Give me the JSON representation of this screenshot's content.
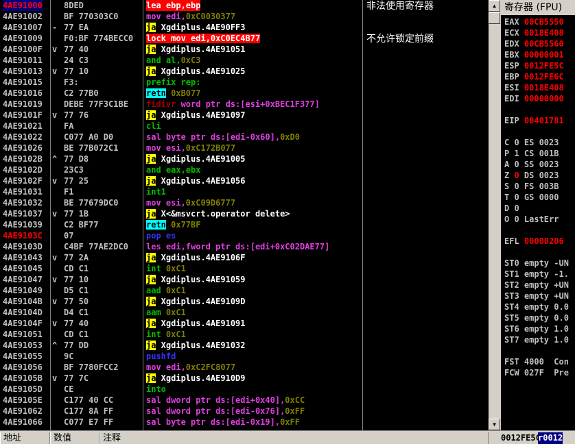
{
  "disasm": {
    "rows": [
      {
        "addr": "4AE91000",
        "jm": "",
        "hex": "8DED",
        "asm": [
          {
            "t": "lea ebp,ebp",
            "c": "mn-white"
          }
        ],
        "style": "row0"
      },
      {
        "addr": "4AE91002",
        "jm": "",
        "hex": "BF 770303C0",
        "asm": [
          {
            "t": "mov edi,",
            "c": "mn-purple"
          },
          {
            "t": "0xC0030377",
            "c": "op-num"
          }
        ]
      },
      {
        "addr": "4AE91007",
        "jm": "-",
        "hex": "77 EA",
        "asm": [
          {
            "t": "ja",
            "c": "mn-yellow"
          },
          {
            "t": " Xgdiplus.4AE90FF3",
            "c": "op-text"
          }
        ]
      },
      {
        "addr": "4AE91009",
        "jm": "",
        "hex": "F0:BF 774BECC0",
        "asm": [
          {
            "t": "lock mov edi,0xC0EC4B77",
            "c": "mn-lockbg"
          }
        ]
      },
      {
        "addr": "4AE9100F",
        "jm": "v",
        "hex": "77 40",
        "asm": [
          {
            "t": "ja",
            "c": "mn-yellow"
          },
          {
            "t": " Xgdiplus.4AE91051",
            "c": "op-text"
          }
        ]
      },
      {
        "addr": "4AE91011",
        "jm": "",
        "hex": "24 C3",
        "asm": [
          {
            "t": "and al,",
            "c": "mn-green"
          },
          {
            "t": "0xC3",
            "c": "op-num"
          }
        ]
      },
      {
        "addr": "4AE91013",
        "jm": "v",
        "hex": "77 10",
        "asm": [
          {
            "t": "ja",
            "c": "mn-yellow"
          },
          {
            "t": " Xgdiplus.4AE91025",
            "c": "op-text"
          }
        ]
      },
      {
        "addr": "4AE91015",
        "jm": "",
        "hex": "F3:",
        "asm": [
          {
            "t": "prefix rep:",
            "c": "mn-green"
          }
        ]
      },
      {
        "addr": "4AE91016",
        "jm": "",
        "hex": "C2 77B0",
        "asm": [
          {
            "t": "retn",
            "c": "mn-cyan"
          },
          {
            "t": " 0xB077",
            "c": "op-num"
          }
        ]
      },
      {
        "addr": "4AE91019",
        "jm": "",
        "hex": "DEBE 77F3C1BE",
        "asm": [
          {
            "t": "fidivr",
            "c": "mn-darkred"
          },
          {
            "t": " word ptr ds:[esi+0xBEC1F377]",
            "c": "op-purple"
          }
        ]
      },
      {
        "addr": "4AE9101F",
        "jm": "v",
        "hex": "77 76",
        "asm": [
          {
            "t": "ja",
            "c": "mn-yellow"
          },
          {
            "t": " Xgdiplus.4AE91097",
            "c": "op-text"
          }
        ]
      },
      {
        "addr": "4AE91021",
        "jm": "",
        "hex": "FA",
        "asm": [
          {
            "t": "cli",
            "c": "mn-green"
          }
        ]
      },
      {
        "addr": "4AE91022",
        "jm": "",
        "hex": "C077 A0 D0",
        "asm": [
          {
            "t": "sal byte ptr ds:[edi-0x60],",
            "c": "mn-purple"
          },
          {
            "t": "0xD0",
            "c": "op-num"
          }
        ]
      },
      {
        "addr": "4AE91026",
        "jm": "",
        "hex": "BE 77B072C1",
        "asm": [
          {
            "t": "mov esi,",
            "c": "mn-purple"
          },
          {
            "t": "0xC172B077",
            "c": "op-num"
          }
        ]
      },
      {
        "addr": "4AE9102B",
        "jm": "^",
        "hex": "77 D8",
        "asm": [
          {
            "t": "ja",
            "c": "mn-yellow"
          },
          {
            "t": " Xgdiplus.4AE91005",
            "c": "op-text"
          }
        ]
      },
      {
        "addr": "4AE9102D",
        "jm": "",
        "hex": "23C3",
        "asm": [
          {
            "t": "and eax,ebx",
            "c": "mn-green"
          }
        ]
      },
      {
        "addr": "4AE9102F",
        "jm": "v",
        "hex": "77 25",
        "asm": [
          {
            "t": "ja",
            "c": "mn-yellow"
          },
          {
            "t": " Xgdiplus.4AE91056",
            "c": "op-text"
          }
        ]
      },
      {
        "addr": "4AE91031",
        "jm": "",
        "hex": "F1",
        "asm": [
          {
            "t": "int1",
            "c": "mn-green"
          }
        ]
      },
      {
        "addr": "4AE91032",
        "jm": "",
        "hex": "BE 77679DC0",
        "asm": [
          {
            "t": "mov esi,",
            "c": "mn-purple"
          },
          {
            "t": "0xC09D6777",
            "c": "op-num"
          }
        ]
      },
      {
        "addr": "4AE91037",
        "jm": "v",
        "hex": "77 1B",
        "asm": [
          {
            "t": "ja",
            "c": "mn-yellow"
          },
          {
            "t": " X<&msvcrt.operator delete>",
            "c": "op-text"
          }
        ]
      },
      {
        "addr": "4AE91039",
        "jm": "",
        "hex": "C2 BF77",
        "asm": [
          {
            "t": "retn",
            "c": "mn-cyan"
          },
          {
            "t": " 0x77BF",
            "c": "op-num"
          }
        ]
      },
      {
        "addr": "4AE9103C",
        "jm": "",
        "hex": "07",
        "asm": [
          {
            "t": "pop es",
            "c": "mn-blue"
          }
        ],
        "addrstyle": "red"
      },
      {
        "addr": "4AE9103D",
        "jm": "",
        "hex": "C4BF 77AE2DC0",
        "asm": [
          {
            "t": "les edi,fword ptr ds:[edi+0xC02DAE77]",
            "c": "mn-purple"
          }
        ]
      },
      {
        "addr": "4AE91043",
        "jm": "v",
        "hex": "77 2A",
        "asm": [
          {
            "t": "ja",
            "c": "mn-yellow"
          },
          {
            "t": " Xgdiplus.4AE9106F",
            "c": "op-text"
          }
        ]
      },
      {
        "addr": "4AE91045",
        "jm": "",
        "hex": "CD C1",
        "asm": [
          {
            "t": "int ",
            "c": "mn-green"
          },
          {
            "t": "0xC1",
            "c": "op-num"
          }
        ]
      },
      {
        "addr": "4AE91047",
        "jm": "v",
        "hex": "77 10",
        "asm": [
          {
            "t": "ja",
            "c": "mn-yellow"
          },
          {
            "t": " Xgdiplus.4AE91059",
            "c": "op-text"
          }
        ]
      },
      {
        "addr": "4AE91049",
        "jm": "",
        "hex": "D5 C1",
        "asm": [
          {
            "t": "aad ",
            "c": "mn-green"
          },
          {
            "t": "0xC1",
            "c": "op-num"
          }
        ]
      },
      {
        "addr": "4AE9104B",
        "jm": "v",
        "hex": "77 50",
        "asm": [
          {
            "t": "ja",
            "c": "mn-yellow"
          },
          {
            "t": " Xgdiplus.4AE9109D",
            "c": "op-text"
          }
        ]
      },
      {
        "addr": "4AE9104D",
        "jm": "",
        "hex": "D4 C1",
        "asm": [
          {
            "t": "aam ",
            "c": "mn-green"
          },
          {
            "t": "0xC1",
            "c": "op-num"
          }
        ]
      },
      {
        "addr": "4AE9104F",
        "jm": "v",
        "hex": "77 40",
        "asm": [
          {
            "t": "ja",
            "c": "mn-yellow"
          },
          {
            "t": " Xgdiplus.4AE91091",
            "c": "op-text"
          }
        ]
      },
      {
        "addr": "4AE91051",
        "jm": "",
        "hex": "CD C1",
        "asm": [
          {
            "t": "int ",
            "c": "mn-green"
          },
          {
            "t": "0xC1",
            "c": "op-num"
          }
        ]
      },
      {
        "addr": "4AE91053",
        "jm": "^",
        "hex": "77 DD",
        "asm": [
          {
            "t": "ja",
            "c": "mn-yellow"
          },
          {
            "t": " Xgdiplus.4AE91032",
            "c": "op-text"
          }
        ]
      },
      {
        "addr": "4AE91055",
        "jm": "",
        "hex": "9C",
        "asm": [
          {
            "t": "pushfd",
            "c": "mn-blue"
          }
        ]
      },
      {
        "addr": "4AE91056",
        "jm": "",
        "hex": "BF 7780FCC2",
        "asm": [
          {
            "t": "mov edi,",
            "c": "mn-purple"
          },
          {
            "t": "0xC2FC8077",
            "c": "op-num"
          }
        ]
      },
      {
        "addr": "4AE9105B",
        "jm": "v",
        "hex": "77 7C",
        "asm": [
          {
            "t": "ja",
            "c": "mn-yellow"
          },
          {
            "t": " Xgdiplus.4AE910D9",
            "c": "op-text"
          }
        ]
      },
      {
        "addr": "4AE9105D",
        "jm": "",
        "hex": "CE",
        "asm": [
          {
            "t": "into",
            "c": "mn-green"
          }
        ]
      },
      {
        "addr": "4AE9105E",
        "jm": "",
        "hex": "C177 40 CC",
        "asm": [
          {
            "t": "sal dword ptr ds:[edi+0x40],",
            "c": "mn-purple"
          },
          {
            "t": "0xCC",
            "c": "op-num"
          }
        ]
      },
      {
        "addr": "4AE91062",
        "jm": "",
        "hex": "C177 8A FF",
        "asm": [
          {
            "t": "sal dword ptr ds:[edi-0x76],",
            "c": "mn-purple"
          },
          {
            "t": "0xFF",
            "c": "op-num"
          }
        ]
      },
      {
        "addr": "4AE91066",
        "jm": "",
        "hex": "C077 E7 FF",
        "asm": [
          {
            "t": "sal byte ptr ds:[edi-0x19],",
            "c": "mn-purple"
          },
          {
            "t": "0xFF",
            "c": "op-num"
          }
        ]
      }
    ],
    "comments": [
      {
        "row": 0,
        "text": "非法使用寄存器"
      },
      {
        "row": 3,
        "text": "不允许锁定前缀"
      }
    ]
  },
  "registers": {
    "title": "寄存器 (FPU)",
    "lines": [
      {
        "y": 0,
        "k": "EAX",
        "v": "00CB5550",
        "c": "rval-red"
      },
      {
        "y": 1,
        "k": "ECX",
        "v": "0018E408",
        "c": "rval-red"
      },
      {
        "y": 2,
        "k": "EDX",
        "v": "00CB5560",
        "c": "rval-red"
      },
      {
        "y": 3,
        "k": "EBX",
        "v": "00000001",
        "c": "rval-red"
      },
      {
        "y": 4,
        "k": "ESP",
        "v": "0012FE5C",
        "c": "rval-red"
      },
      {
        "y": 5,
        "k": "EBP",
        "v": "0012FE6C",
        "c": "rval-red"
      },
      {
        "y": 6,
        "k": "ESI",
        "v": "0018E408",
        "c": "rval-red"
      },
      {
        "y": 7,
        "k": "EDI",
        "v": "00000000",
        "c": "rval-red"
      },
      {
        "y": 9,
        "k": "EIP",
        "v": "00401781",
        "c": "rval-red"
      },
      {
        "y": 11,
        "k": "C 0",
        "v": "ES 0023",
        "c": "rval-gray"
      },
      {
        "y": 12,
        "k": "P 1",
        "v": "CS 001B",
        "c": "rval-gray"
      },
      {
        "y": 13,
        "k": "A 0",
        "v": "SS 0023",
        "c": "rval-gray"
      },
      {
        "y": 14,
        "k": "Z 0",
        "v": "DS 0023",
        "c": "rval-gray",
        "zred": true
      },
      {
        "y": 15,
        "k": "S 0",
        "v": "FS 003B",
        "c": "rval-gray"
      },
      {
        "y": 16,
        "k": "T 0",
        "v": "GS 0000",
        "c": "rval-gray"
      },
      {
        "y": 17,
        "k": "D 0",
        "v": "",
        "c": "rval-gray"
      },
      {
        "y": 18,
        "k": "O 0",
        "v": "LastErr",
        "c": "rval-gray"
      },
      {
        "y": 20,
        "k": "EFL",
        "v": "00000206",
        "c": "rval-red"
      },
      {
        "y": 22,
        "k": "ST0",
        "v": "empty -UN",
        "c": "rval-gray"
      },
      {
        "y": 23,
        "k": "ST1",
        "v": "empty -1.",
        "c": "rval-gray"
      },
      {
        "y": 24,
        "k": "ST2",
        "v": "empty +UN",
        "c": "rval-gray"
      },
      {
        "y": 25,
        "k": "ST3",
        "v": "empty +UN",
        "c": "rval-gray"
      },
      {
        "y": 26,
        "k": "ST4",
        "v": "empty 0.0",
        "c": "rval-gray"
      },
      {
        "y": 27,
        "k": "ST5",
        "v": "empty 0.0",
        "c": "rval-gray"
      },
      {
        "y": 28,
        "k": "ST6",
        "v": "empty 1.0",
        "c": "rval-gray"
      },
      {
        "y": 29,
        "k": "ST7",
        "v": "empty 1.0",
        "c": "rval-gray"
      },
      {
        "y": 31,
        "k": "FST",
        "v": "4000  Con",
        "c": "rval-gray"
      },
      {
        "y": 32,
        "k": "FCW",
        "v": "027F  Pre",
        "c": "rval-gray"
      }
    ]
  },
  "bottom": {
    "col_addr": "地址",
    "col_data": "数值",
    "col_comment": "注释",
    "stack_addr": "0012FE5C",
    "stack_val": "r0012"
  },
  "scrollbar": {
    "up": "▲",
    "down": "▼"
  }
}
